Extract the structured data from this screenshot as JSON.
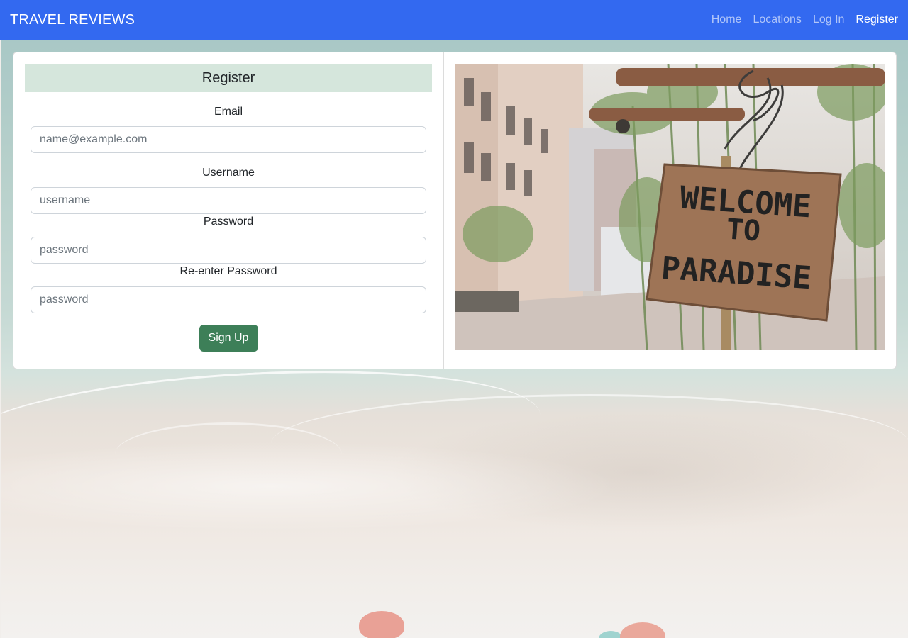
{
  "navbar": {
    "brand": "TRAVEL REVIEWS",
    "links": [
      {
        "label": "Home",
        "active": false
      },
      {
        "label": "Locations",
        "active": false
      },
      {
        "label": "Log In",
        "active": false
      },
      {
        "label": "Register",
        "active": true
      }
    ],
    "color": "#3369f0"
  },
  "form": {
    "title": "Register",
    "fields": [
      {
        "label": "Email",
        "placeholder": "name@example.com",
        "value": ""
      },
      {
        "label": "Username",
        "placeholder": "username",
        "value": ""
      },
      {
        "label": "Password",
        "placeholder": "password",
        "value": ""
      },
      {
        "label": "Re-enter Password",
        "placeholder": "password",
        "value": ""
      }
    ],
    "submit_label": "Sign Up",
    "header_color": "#d5e6dc",
    "button_color": "#3d7f58"
  },
  "photo": {
    "sign_lines": [
      "WELCOME",
      "TO",
      "PARADISE"
    ]
  }
}
